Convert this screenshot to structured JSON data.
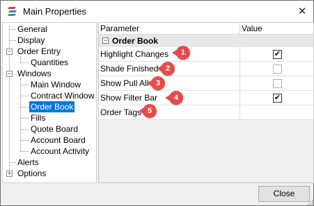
{
  "window": {
    "title": "Main Properties",
    "close_glyph": "✕"
  },
  "tree": {
    "items": [
      {
        "label": "General"
      },
      {
        "label": "Display"
      },
      {
        "label": "Order Entry",
        "expander": "−"
      },
      {
        "label": "Quantities"
      },
      {
        "label": "Windows",
        "expander": "−"
      },
      {
        "label": "Main Window"
      },
      {
        "label": "Contract Window"
      },
      {
        "label": "Order Book",
        "selected": true
      },
      {
        "label": "Fills"
      },
      {
        "label": "Quote Board"
      },
      {
        "label": "Account Board"
      },
      {
        "label": "Account Activity"
      },
      {
        "label": "Alerts"
      },
      {
        "label": "Options",
        "expander": "+"
      }
    ]
  },
  "grid": {
    "headers": {
      "parameter": "Parameter",
      "value": "Value"
    },
    "section": {
      "expander": "−",
      "title": "Order Book"
    },
    "rows": [
      {
        "name": "Highlight Changes",
        "checked": true,
        "glyph": "✔",
        "badge": "1"
      },
      {
        "name": "Shade Finished",
        "checked": false,
        "glyph": "",
        "badge": "2"
      },
      {
        "name": "Show Pull All",
        "checked": false,
        "glyph": "",
        "badge": "3"
      },
      {
        "name": "Show Filter Bar",
        "checked": true,
        "glyph": "✔",
        "badge": "4"
      },
      {
        "name": "Order Tags",
        "checked": null,
        "glyph": "",
        "badge": "5"
      }
    ]
  },
  "footer": {
    "close_label": "Close"
  },
  "colors": {
    "selection": "#0078d7",
    "badge": "#e84b4b"
  }
}
